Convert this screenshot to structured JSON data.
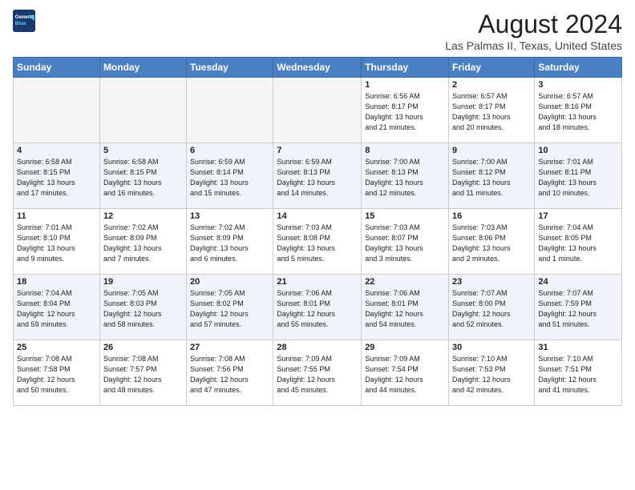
{
  "header": {
    "logo_line1": "General",
    "logo_line2": "Blue",
    "title": "August 2024",
    "subtitle": "Las Palmas II, Texas, United States"
  },
  "weekdays": [
    "Sunday",
    "Monday",
    "Tuesday",
    "Wednesday",
    "Thursday",
    "Friday",
    "Saturday"
  ],
  "weeks": [
    [
      {
        "day": "",
        "text": ""
      },
      {
        "day": "",
        "text": ""
      },
      {
        "day": "",
        "text": ""
      },
      {
        "day": "",
        "text": ""
      },
      {
        "day": "1",
        "text": "Sunrise: 6:56 AM\nSunset: 8:17 PM\nDaylight: 13 hours\nand 21 minutes."
      },
      {
        "day": "2",
        "text": "Sunrise: 6:57 AM\nSunset: 8:17 PM\nDaylight: 13 hours\nand 20 minutes."
      },
      {
        "day": "3",
        "text": "Sunrise: 6:57 AM\nSunset: 8:16 PM\nDaylight: 13 hours\nand 18 minutes."
      }
    ],
    [
      {
        "day": "4",
        "text": "Sunrise: 6:58 AM\nSunset: 8:15 PM\nDaylight: 13 hours\nand 17 minutes."
      },
      {
        "day": "5",
        "text": "Sunrise: 6:58 AM\nSunset: 8:15 PM\nDaylight: 13 hours\nand 16 minutes."
      },
      {
        "day": "6",
        "text": "Sunrise: 6:59 AM\nSunset: 8:14 PM\nDaylight: 13 hours\nand 15 minutes."
      },
      {
        "day": "7",
        "text": "Sunrise: 6:59 AM\nSunset: 8:13 PM\nDaylight: 13 hours\nand 14 minutes."
      },
      {
        "day": "8",
        "text": "Sunrise: 7:00 AM\nSunset: 8:13 PM\nDaylight: 13 hours\nand 12 minutes."
      },
      {
        "day": "9",
        "text": "Sunrise: 7:00 AM\nSunset: 8:12 PM\nDaylight: 13 hours\nand 11 minutes."
      },
      {
        "day": "10",
        "text": "Sunrise: 7:01 AM\nSunset: 8:11 PM\nDaylight: 13 hours\nand 10 minutes."
      }
    ],
    [
      {
        "day": "11",
        "text": "Sunrise: 7:01 AM\nSunset: 8:10 PM\nDaylight: 13 hours\nand 9 minutes."
      },
      {
        "day": "12",
        "text": "Sunrise: 7:02 AM\nSunset: 8:09 PM\nDaylight: 13 hours\nand 7 minutes."
      },
      {
        "day": "13",
        "text": "Sunrise: 7:02 AM\nSunset: 8:09 PM\nDaylight: 13 hours\nand 6 minutes."
      },
      {
        "day": "14",
        "text": "Sunrise: 7:03 AM\nSunset: 8:08 PM\nDaylight: 13 hours\nand 5 minutes."
      },
      {
        "day": "15",
        "text": "Sunrise: 7:03 AM\nSunset: 8:07 PM\nDaylight: 13 hours\nand 3 minutes."
      },
      {
        "day": "16",
        "text": "Sunrise: 7:03 AM\nSunset: 8:06 PM\nDaylight: 13 hours\nand 2 minutes."
      },
      {
        "day": "17",
        "text": "Sunrise: 7:04 AM\nSunset: 8:05 PM\nDaylight: 13 hours\nand 1 minute."
      }
    ],
    [
      {
        "day": "18",
        "text": "Sunrise: 7:04 AM\nSunset: 8:04 PM\nDaylight: 12 hours\nand 59 minutes."
      },
      {
        "day": "19",
        "text": "Sunrise: 7:05 AM\nSunset: 8:03 PM\nDaylight: 12 hours\nand 58 minutes."
      },
      {
        "day": "20",
        "text": "Sunrise: 7:05 AM\nSunset: 8:02 PM\nDaylight: 12 hours\nand 57 minutes."
      },
      {
        "day": "21",
        "text": "Sunrise: 7:06 AM\nSunset: 8:01 PM\nDaylight: 12 hours\nand 55 minutes."
      },
      {
        "day": "22",
        "text": "Sunrise: 7:06 AM\nSunset: 8:01 PM\nDaylight: 12 hours\nand 54 minutes."
      },
      {
        "day": "23",
        "text": "Sunrise: 7:07 AM\nSunset: 8:00 PM\nDaylight: 12 hours\nand 52 minutes."
      },
      {
        "day": "24",
        "text": "Sunrise: 7:07 AM\nSunset: 7:59 PM\nDaylight: 12 hours\nand 51 minutes."
      }
    ],
    [
      {
        "day": "25",
        "text": "Sunrise: 7:08 AM\nSunset: 7:58 PM\nDaylight: 12 hours\nand 50 minutes."
      },
      {
        "day": "26",
        "text": "Sunrise: 7:08 AM\nSunset: 7:57 PM\nDaylight: 12 hours\nand 48 minutes."
      },
      {
        "day": "27",
        "text": "Sunrise: 7:08 AM\nSunset: 7:56 PM\nDaylight: 12 hours\nand 47 minutes."
      },
      {
        "day": "28",
        "text": "Sunrise: 7:09 AM\nSunset: 7:55 PM\nDaylight: 12 hours\nand 45 minutes."
      },
      {
        "day": "29",
        "text": "Sunrise: 7:09 AM\nSunset: 7:54 PM\nDaylight: 12 hours\nand 44 minutes."
      },
      {
        "day": "30",
        "text": "Sunrise: 7:10 AM\nSunset: 7:53 PM\nDaylight: 12 hours\nand 42 minutes."
      },
      {
        "day": "31",
        "text": "Sunrise: 7:10 AM\nSunset: 7:51 PM\nDaylight: 12 hours\nand 41 minutes."
      }
    ]
  ]
}
